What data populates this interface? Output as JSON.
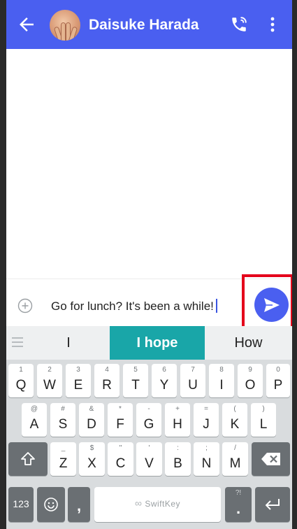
{
  "header": {
    "contact_name": "Daisuke Harada",
    "icons": {
      "back": "back-arrow-icon",
      "call": "phone-call-icon",
      "menu": "more-vertical-icon"
    },
    "accent": "#4a5ff0"
  },
  "composer": {
    "message_text": "Go for lunch? It's been a while!",
    "icons": {
      "add": "add-circle-icon",
      "send": "send-icon"
    },
    "highlight_color": "#e4001b"
  },
  "suggestions": {
    "left": "I",
    "center": "I hope",
    "right": "How",
    "center_color": "#19a6a8"
  },
  "keyboard": {
    "brand_label": "SwiftKey",
    "numbers_label": "123",
    "comma_label": ",",
    "period_label": ".",
    "period_sub": "?!",
    "row1": [
      {
        "main": "Q",
        "sub": "1"
      },
      {
        "main": "W",
        "sub": "2"
      },
      {
        "main": "E",
        "sub": "3"
      },
      {
        "main": "R",
        "sub": "4"
      },
      {
        "main": "T",
        "sub": "5"
      },
      {
        "main": "Y",
        "sub": "6"
      },
      {
        "main": "U",
        "sub": "7"
      },
      {
        "main": "I",
        "sub": "8"
      },
      {
        "main": "O",
        "sub": "9"
      },
      {
        "main": "P",
        "sub": "0"
      }
    ],
    "row2": [
      {
        "main": "A",
        "sub": "@"
      },
      {
        "main": "S",
        "sub": "#"
      },
      {
        "main": "D",
        "sub": "&"
      },
      {
        "main": "F",
        "sub": "*"
      },
      {
        "main": "G",
        "sub": "-"
      },
      {
        "main": "H",
        "sub": "+"
      },
      {
        "main": "J",
        "sub": "="
      },
      {
        "main": "K",
        "sub": "("
      },
      {
        "main": "L",
        "sub": ")"
      }
    ],
    "row3": [
      {
        "main": "Z",
        "sub": "_"
      },
      {
        "main": "X",
        "sub": "$"
      },
      {
        "main": "C",
        "sub": "\""
      },
      {
        "main": "V",
        "sub": "'"
      },
      {
        "main": "B",
        "sub": ":"
      },
      {
        "main": "N",
        "sub": ";"
      },
      {
        "main": "M",
        "sub": "/"
      }
    ]
  }
}
